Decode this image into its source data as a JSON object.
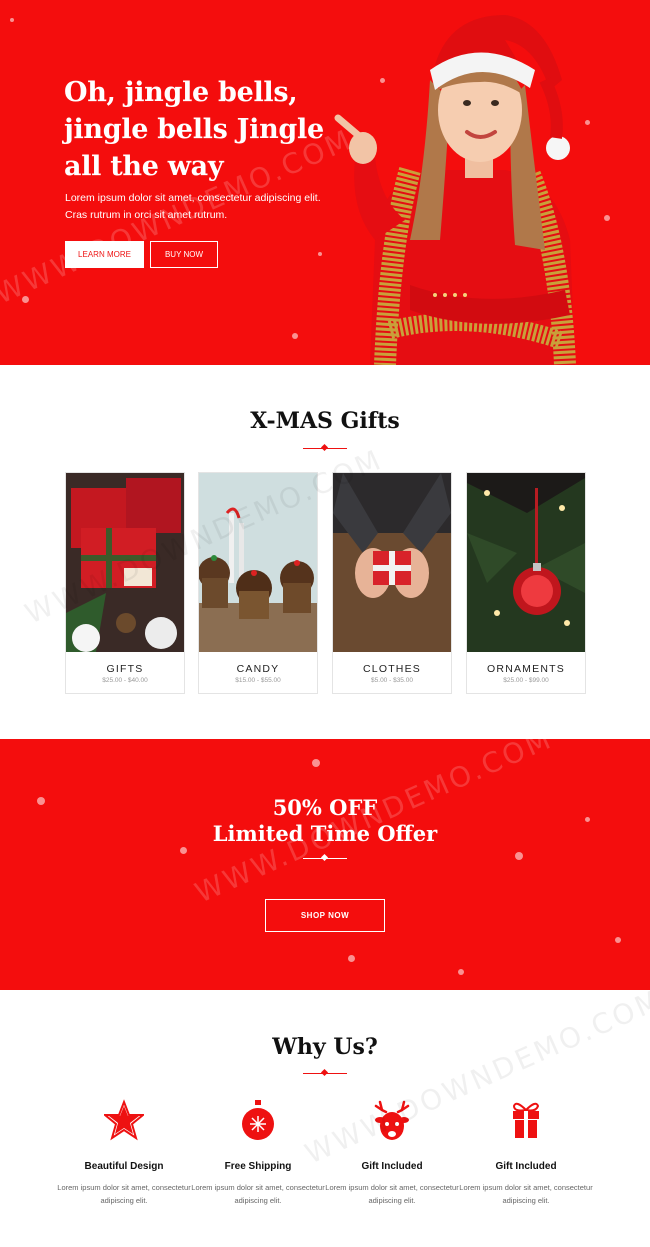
{
  "hero": {
    "headline": "Oh, jingle bells, jingle bells Jingle all the way",
    "text": "Lorem ipsum dolor sit amet, consectetur adipiscing elit. Cras rutrum in orci sit amet rutrum.",
    "learn_more": "LEARN MORE",
    "buy_now": "BUY NOW"
  },
  "gifts": {
    "title": "X-MAS Gifts",
    "items": [
      {
        "name": "GIFTS",
        "price": "$25.00 - $40.00"
      },
      {
        "name": "CANDY",
        "price": "$15.00 - $55.00"
      },
      {
        "name": "CLOTHES",
        "price": "$5.00 - $35.00"
      },
      {
        "name": "ORNAMENTS",
        "price": "$25.00 - $99.00"
      }
    ]
  },
  "offer": {
    "line1": "50% OFF",
    "line2": "Limited Time Offer",
    "shop_now": "SHOP NOW"
  },
  "why": {
    "title": "Why Us?",
    "features": [
      {
        "title": "Beautiful Design",
        "desc": "Lorem ipsum dolor sit amet, consectetur adipiscing elit.",
        "icon": "star-icon"
      },
      {
        "title": "Free Shipping",
        "desc": "Lorem ipsum dolor sit amet, consectetur adipiscing elit.",
        "icon": "ornament-icon"
      },
      {
        "title": "Gift Included",
        "desc": "Lorem ipsum dolor sit amet, consectetur adipiscing elit.",
        "icon": "reindeer-icon"
      },
      {
        "title": "Gift Included",
        "desc": "Lorem ipsum dolor sit amet, consectetur adipiscing elit.",
        "icon": "gift-box-icon"
      }
    ]
  },
  "colors": {
    "accent": "#f40d0d",
    "text": "#111111"
  },
  "watermark": "WWW.DOWNDEMO.COM"
}
